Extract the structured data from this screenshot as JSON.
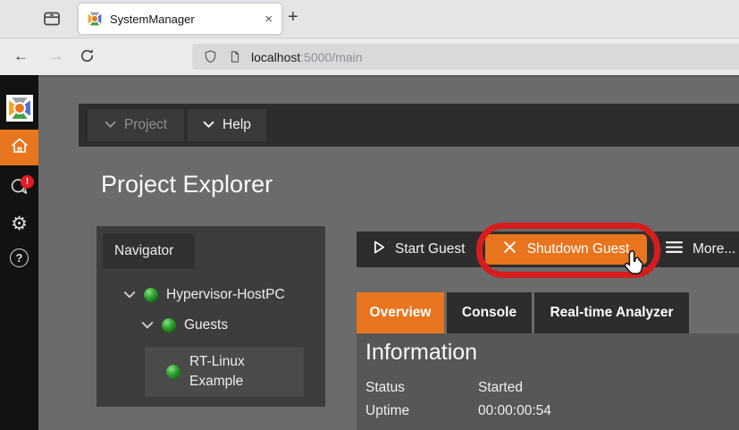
{
  "browser": {
    "tab_title": "SystemManager",
    "tab_close": "×",
    "new_tab": "+",
    "url_host": "localhost",
    "url_rest": ":5000/main",
    "back": "←",
    "forward": "→"
  },
  "sidebar": {
    "badge": "!",
    "gear_glyph": "⚙",
    "help_glyph": "?"
  },
  "menubar": {
    "project_label": "Project",
    "help_label": "Help"
  },
  "main": {
    "title": "Project Explorer"
  },
  "navigator": {
    "title": "Navigator",
    "items": [
      {
        "label": "Hypervisor-HostPC",
        "level": 0,
        "expanded": true,
        "status": "green"
      },
      {
        "label": "Guests",
        "level": 1,
        "expanded": true,
        "status": "green"
      },
      {
        "label": "RT-Linux Example",
        "line1": "RT-Linux",
        "line2": "Example",
        "level": 2,
        "status": "green",
        "selected": true
      }
    ]
  },
  "actions": {
    "start": "Start Guest",
    "shutdown": "Shutdown Guest",
    "more": "More...",
    "shutdown_highlighted": true
  },
  "tabs": [
    {
      "label": "Overview",
      "active": true
    },
    {
      "label": "Console",
      "active": false
    },
    {
      "label": "Real-time Analyzer",
      "active": false
    }
  ],
  "info": {
    "heading": "Information",
    "rows": [
      {
        "label": "Status",
        "value": "Started"
      },
      {
        "label": "Uptime",
        "value": "00:00:00:54"
      }
    ]
  },
  "colors": {
    "accent_orange": "#e8751f",
    "annotation_red": "#d51d1d",
    "status_green": "#2da02d",
    "badge_red": "#e01b24",
    "dark_strip": "#2d2d2d",
    "page_gray": "#6b6b6b"
  }
}
